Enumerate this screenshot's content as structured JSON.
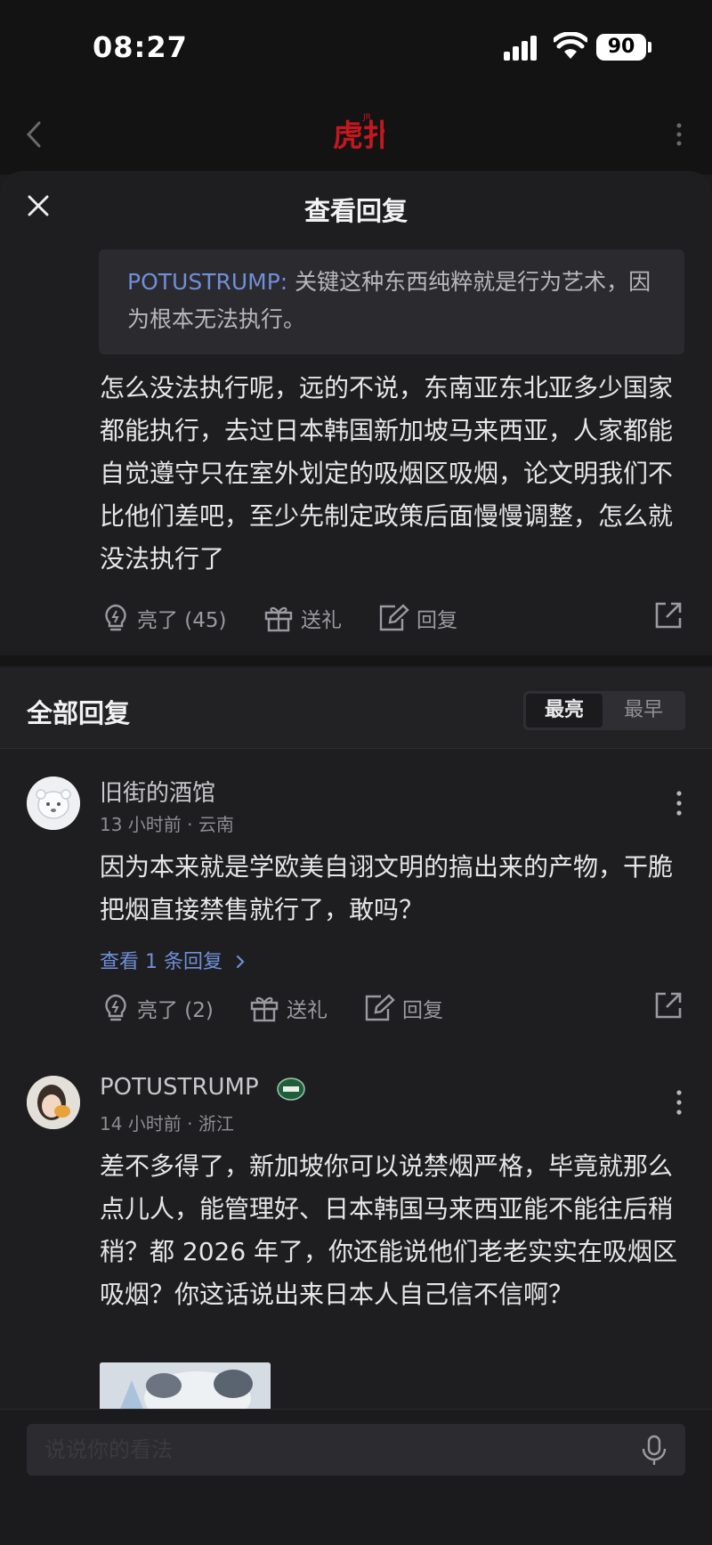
{
  "status_bar": {
    "time": "08:27",
    "battery": "90"
  },
  "navbar": {
    "logo_text": "虎扑"
  },
  "sheet": {
    "title": "查看回复",
    "quote": {
      "author": "POTUSTRUMP:",
      "text": " 关键这种东西纯粹就是行为艺术，因为根本无法执行。"
    },
    "main_text": "怎么没法执行呢，远的不说，东南亚东北亚多少国家都能执行，去过日本韩国新加坡马来西亚，人家都能自觉遵守只在室外划定的吸烟区吸烟，论文明我们不比他们差吧，至少先制定政策后面慢慢调整，怎么就没法执行了",
    "actions": {
      "light": "亮了 (45)",
      "gift": "送礼",
      "reply": "回复"
    }
  },
  "replies_section": {
    "title": "全部回复",
    "sort_tabs": [
      "最亮",
      "最早"
    ]
  },
  "comments": [
    {
      "username": "旧街的酒馆",
      "meta": "13 小时前 · 云南",
      "text": "因为本来就是学欧美自诩文明的搞出来的产物，干脆把烟直接禁售就行了，敢吗？",
      "view_replies": "查看 1 条回复",
      "actions": {
        "light": "亮了 (2)",
        "gift": "送礼",
        "reply": "回复"
      }
    },
    {
      "username": "POTUSTRUMP",
      "meta": "14 小时前 · 浙江",
      "text": "差不多得了，新加坡你可以说禁烟严格，毕竟就那么点儿人，能管理好、日本韩国马来西亚能不能往后稍稍？都 2026 年了，你还能说他们老老实实在吸烟区吸烟？你这话说出来日本人自己信不信啊？"
    }
  ],
  "bottom_bar": {
    "input_placeholder": "说说你的看法"
  },
  "colors": {
    "accent": "#6f8fd8",
    "background": "#1e1e20",
    "logo": "#c4181e"
  }
}
